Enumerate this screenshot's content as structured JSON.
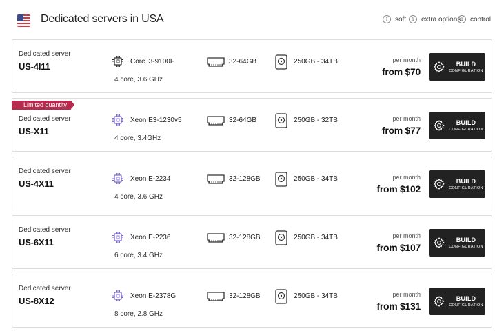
{
  "header": {
    "title": "Dedicated servers in USA",
    "flag_icon": "us-flag-icon",
    "options": [
      {
        "label": "soft"
      },
      {
        "label": "extra options"
      },
      {
        "label": "control"
      }
    ]
  },
  "colors": {
    "accent": "#b8294e",
    "button_bg": "#222222",
    "cpu_icon_regular": "#333333",
    "cpu_icon_xeon": "#7d6bd6"
  },
  "servers": [
    {
      "caption": "Dedicated server",
      "name": "US-4I11",
      "cpu_model": "Core i3-9100F",
      "cpu_detail": "4 core, 3.6 GHz",
      "ram": "32-64GB",
      "disk": "250GB - 34TB",
      "per_month": "per month",
      "price": "from $70",
      "build_label": "BUILD",
      "build_sub": "CONFIGURATION"
    },
    {
      "badge": "Limited quantity",
      "caption": "Dedicated server",
      "name": "US-X11",
      "cpu_model": "Xeon E3-1230v5",
      "cpu_detail": "4 core, 3.4GHz",
      "ram": "32-64GB",
      "disk": "250GB - 32TB",
      "per_month": "per month",
      "price": "from $77",
      "build_label": "BUILD",
      "build_sub": "CONFIGURATION"
    },
    {
      "caption": "Dedicated server",
      "name": "US-4X11",
      "cpu_model": "Xeon E-2234",
      "cpu_detail": "4 core, 3.6 GHz",
      "ram": "32-128GB",
      "disk": "250GB - 34TB",
      "per_month": "per month",
      "price": "from $102",
      "build_label": "BUILD",
      "build_sub": "CONFIGURATION"
    },
    {
      "caption": "Dedicated server",
      "name": "US-6X11",
      "cpu_model": "Xeon E-2236",
      "cpu_detail": "6 core, 3.4 GHz",
      "ram": "32-128GB",
      "disk": "250GB - 34TB",
      "per_month": "per month",
      "price": "from $107",
      "build_label": "BUILD",
      "build_sub": "CONFIGURATION"
    },
    {
      "caption": "Dedicated server",
      "name": "US-8X12",
      "cpu_model": "Xeon E-2378G",
      "cpu_detail": "8 core, 2.8 GHz",
      "ram": "32-128GB",
      "disk": "250GB - 34TB",
      "per_month": "per month",
      "price": "from $131",
      "build_label": "BUILD",
      "build_sub": "CONFIGURATION"
    }
  ]
}
